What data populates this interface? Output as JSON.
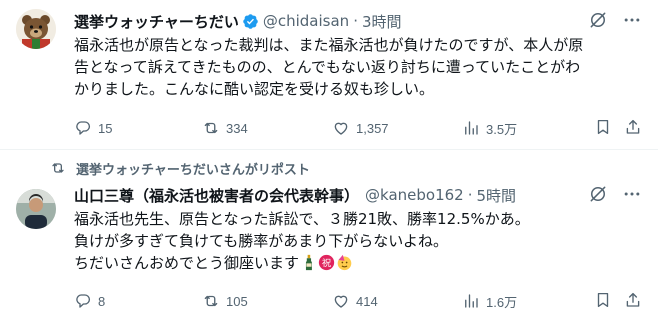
{
  "tweets": [
    {
      "display_name": "選挙ウォッチャーちだい",
      "handle": "@chidaisan",
      "separator": "·",
      "time": "3時間",
      "text_lines": [
        "福永活也が原告となった裁判は、また福永活也が負けたのですが、本人が原",
        "告となって訴えてきたものの、とんでもない返り討ちに遭っていたことがわ",
        "かりました。こんなに酷い認定を受ける奴も珍しい。"
      ],
      "replies": "15",
      "reposts": "334",
      "likes": "1,357",
      "views": "3.5万",
      "verified": true
    },
    {
      "repost_context": "選挙ウォッチャーちだいさんがリポスト",
      "display_name": "山口三尊（福永活也被害者の会代表幹事）",
      "handle": "@kanebo162",
      "separator": "·",
      "time": "5時間",
      "text_lines": [
        "福永活也先生、原告となった訴訟で、３勝21敗、勝率12.5%かあ。",
        "負けが多すぎて負けても勝率があまり下がらないよね。",
        "ちだいさんおめでとう御座います"
      ],
      "replies": "8",
      "reposts": "105",
      "likes": "414",
      "views": "1.6万",
      "verified": false
    }
  ],
  "icons": {
    "verified": "verified-badge-icon",
    "grok": "grok-icon",
    "more": "more-icon",
    "reply": "reply-icon",
    "repost": "repost-icon",
    "like": "heart-icon",
    "views": "views-chart-icon",
    "bookmark": "bookmark-icon",
    "share": "share-icon",
    "emojis": [
      "champagne-icon",
      "congratulations-icon",
      "party-face-icon"
    ]
  },
  "colors": {
    "text": "#0f1419",
    "secondary": "#536471",
    "verified": "#1d9bf0",
    "divider": "#eff3f4"
  }
}
